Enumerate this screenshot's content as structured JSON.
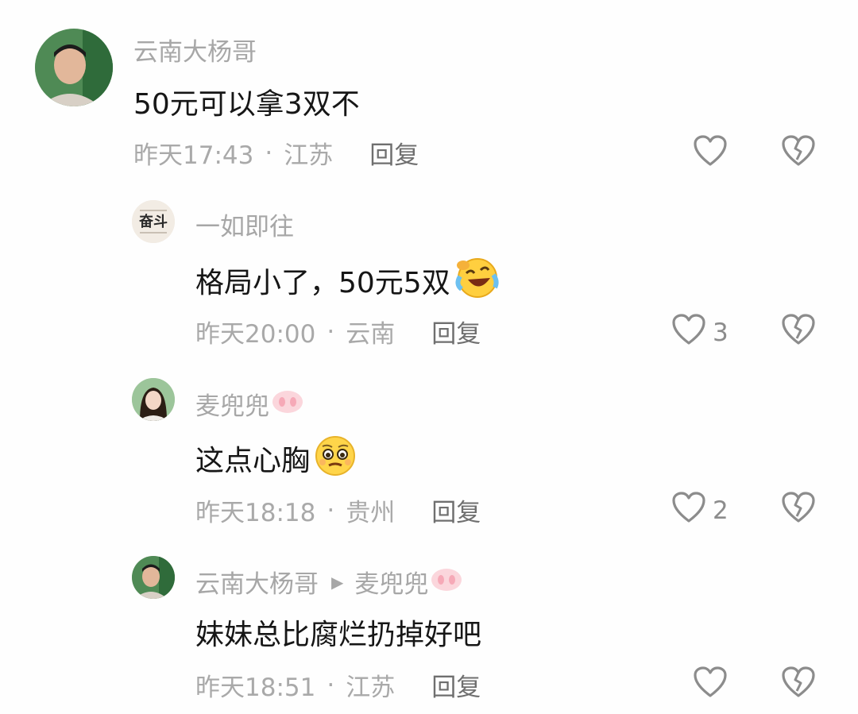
{
  "comments": [
    {
      "user": "云南大杨哥",
      "text": "50元可以拿3双不",
      "time": "昨天17:43",
      "dot": "·",
      "location": "江苏",
      "reply": "回复",
      "likes": ""
    },
    {
      "user": "一如即往",
      "text": "格局小了，50元5双",
      "time": "昨天20:00",
      "dot": "·",
      "location": "云南",
      "reply": "回复",
      "likes": "3",
      "avatar_text": "奋斗"
    },
    {
      "user": "麦兜兜",
      "text": "这点心胸",
      "time": "昨天18:18",
      "dot": "·",
      "location": "贵州",
      "reply": "回复",
      "likes": "2"
    },
    {
      "user": "云南大杨哥",
      "reply_to": "麦兜兜",
      "text": "妹妹总比腐烂扔掉好吧",
      "time": "昨天18:51",
      "dot": "·",
      "location": "江苏",
      "reply": "回复",
      "likes": ""
    }
  ],
  "icons": {
    "like": "heart-outline-icon",
    "dislike": "broken-heart-icon",
    "reply_arrow": "play-arrow-icon",
    "pig_emoji": "pig-nose-emoji",
    "laugh_emoji": "laughing-crying-emoji",
    "pleading_emoji": "pleading-face-emoji"
  },
  "colors": {
    "text": "#161616",
    "muted": "#a7a7a7",
    "reply": "#6f6f6f",
    "icon": "#8c8c8c"
  }
}
